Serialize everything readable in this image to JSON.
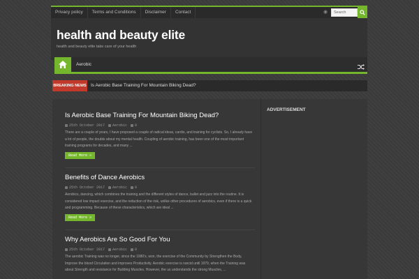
{
  "top_nav": {
    "links": [
      "Privacy policy",
      "Terms and Conditions",
      "Disclaimer",
      "Contact"
    ],
    "search_placeholder": "Search",
    "rss_icon": "rss-icon",
    "search_icon": "search-icon"
  },
  "header": {
    "title": "health and beauty elite",
    "tagline": "health and beauty elite take care of your health"
  },
  "main_nav": {
    "home_icon": "home-icon",
    "items": [
      "Aerobic"
    ],
    "shuffle_icon": "shuffle-icon"
  },
  "breaking": {
    "label": "BREAKING NEWS",
    "text": "Is Aerobic Base Training For Mountain Biking Dead?"
  },
  "posts": [
    {
      "title": "Is Aerobic Base Training For Mountain Biking Dead?",
      "date": "25th October 2017",
      "category": "Aerobic",
      "comments": "0",
      "excerpt": "There are a couple of years, I have proposed a couple of radical ideas, cardio, and training for cyclists. So, I already have a lot of people, the doubts about my mental health. Coupling of aerobic training, has been one of the most important training programs for decades, and many ...",
      "read_more": "Read More »"
    },
    {
      "title": "Benefits of Dance Aerobics",
      "date": "25th October 2017",
      "category": "Aerobic",
      "comments": "0",
      "excerpt": "Aerobics, dancing, which combines the training and the different styles of dance, ballet and jazz into the routine. It is considered low impact exercise, and the reduction of the risk, unlike other procedures of aerobics, even if there is a quick and programming. Because of these characteristics, which are ideal ...",
      "read_more": "Read More »"
    },
    {
      "title": "Why Aerobics Are So Good For You",
      "date": "25th October 2017",
      "category": "Aerobic",
      "comments": "0",
      "excerpt": "The aerobic Training was no longer, since the 1980's, won, the exercise of the Community by Strengthen the Body, Improve the blood Circulation and improves Productivity. Aerobic exercise is rancid until 1979, when the Training was about Strength and resistance for Building Muscles. However, the us understands the strong Muscles, ..."
    }
  ],
  "sidebar": {
    "widget_title": "ADVERTISEMENT"
  },
  "colors": {
    "accent": "#75b72c",
    "breaking": "#c0392b",
    "background": "#3a3a3a"
  }
}
